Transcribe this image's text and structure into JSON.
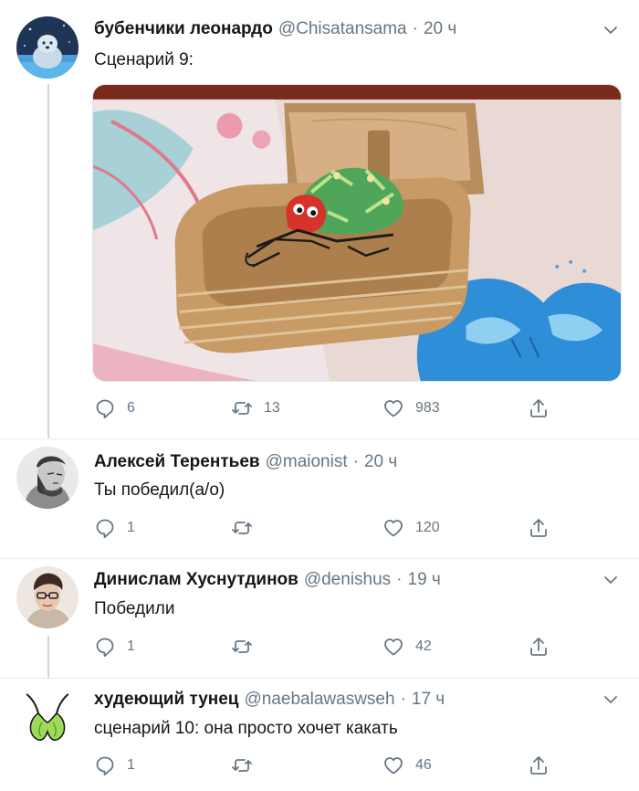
{
  "tweets": [
    {
      "name": "бубенчики леонардо",
      "handle": "@Chisatansama",
      "time": "20 ч",
      "text": "Сценарий 9:",
      "replies": "6",
      "retweets": "13",
      "likes": "983",
      "has_menu": true
    },
    {
      "name": "Алексей Терентьев",
      "handle": "@maionist",
      "time": "20 ч",
      "text": "Ты победил(а/о)",
      "replies": "1",
      "retweets": "",
      "likes": "120",
      "has_menu": false
    },
    {
      "name": "Динислам Хуснутдинов",
      "handle": "@denishus",
      "time": "19 ч",
      "text": "Победили",
      "replies": "1",
      "retweets": "",
      "likes": "42",
      "has_menu": true
    },
    {
      "name": "худеющий тунец",
      "handle": "@naebalawaswseh",
      "time": "17 ч",
      "text": "сценарий 10: она просто хочет какать",
      "replies": "1",
      "retweets": "",
      "likes": "46",
      "has_menu": true
    }
  ],
  "colors": {
    "text": "#14171a",
    "secondary": "#657786",
    "divider": "#e6ecf0",
    "thread_line": "#ccd6dd"
  },
  "icons": {
    "reply": "reply-icon",
    "retweet": "retweet-icon",
    "like": "like-icon",
    "share": "share-icon",
    "menu": "chevron-down-icon"
  }
}
